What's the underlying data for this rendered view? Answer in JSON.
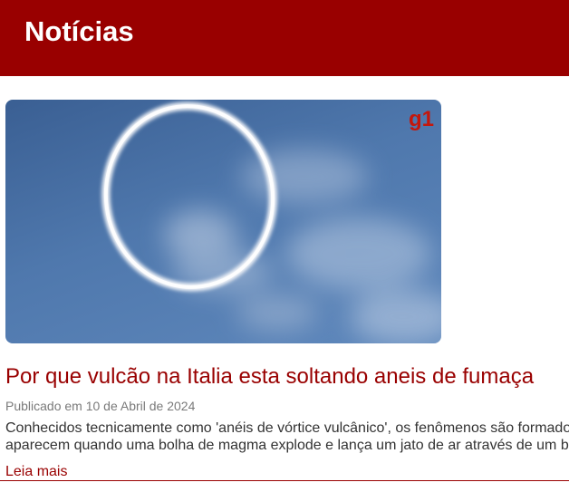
{
  "header": {
    "title": "Notícias"
  },
  "article": {
    "image_brand": "g1",
    "headline": "Por que vulcão na Italia esta soltando aneis de fumaça",
    "date": "Publicado em 10 de Abril de 2024",
    "summary_lines": [
      "Conhecidos tecnicamente como 'anéis de vórtice vulcânico', os fenômenos são formados",
      "aparecem quando uma bolha de magma explode e lança um jato de ar através de um b"
    ],
    "read_more": "Leia mais"
  },
  "colors": {
    "header_background": "#990000",
    "headline": "#990000",
    "brand_mark": "#c4170c"
  }
}
